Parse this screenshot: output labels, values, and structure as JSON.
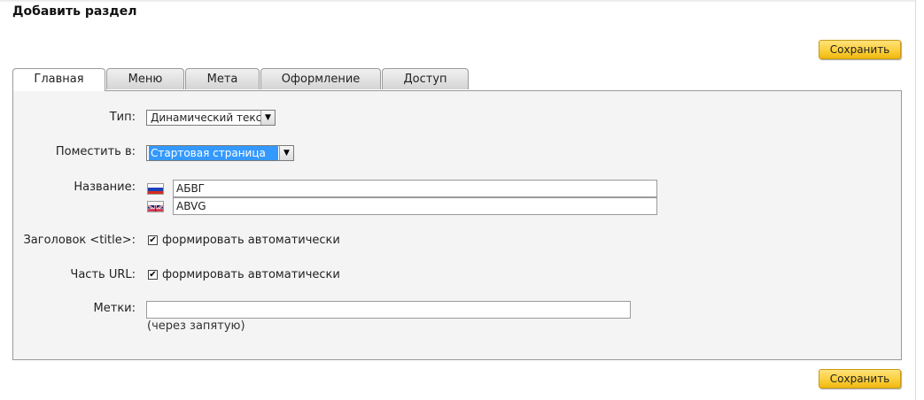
{
  "page": {
    "title": "Добавить раздел"
  },
  "actions": {
    "save_label": "Сохранить"
  },
  "tabs": [
    {
      "label": "Главная",
      "active": true
    },
    {
      "label": "Меню",
      "active": false
    },
    {
      "label": "Мета",
      "active": false
    },
    {
      "label": "Оформление",
      "active": false
    },
    {
      "label": "Доступ",
      "active": false
    }
  ],
  "form": {
    "type": {
      "label": "Тип:",
      "value": "Динамический текст"
    },
    "place_in": {
      "label": "Поместить в:",
      "value": "Стартовая страница"
    },
    "name": {
      "label": "Название:",
      "ru_value": "АБВГ",
      "en_value": "ABVG"
    },
    "title_tag": {
      "label": "Заголовок <title>:",
      "checkbox_label": "формировать автоматически",
      "checked": true
    },
    "url_part": {
      "label": "Часть URL:",
      "checkbox_label": "формировать автоматически",
      "checked": true
    },
    "tags": {
      "label": "Метки:",
      "value": "",
      "hint": "(через запятую)"
    }
  },
  "icons": {
    "checkmark": "✔",
    "dropdown": "▼",
    "flag_ru": "flag-ru-icon",
    "flag_en": "flag-uk-icon"
  }
}
